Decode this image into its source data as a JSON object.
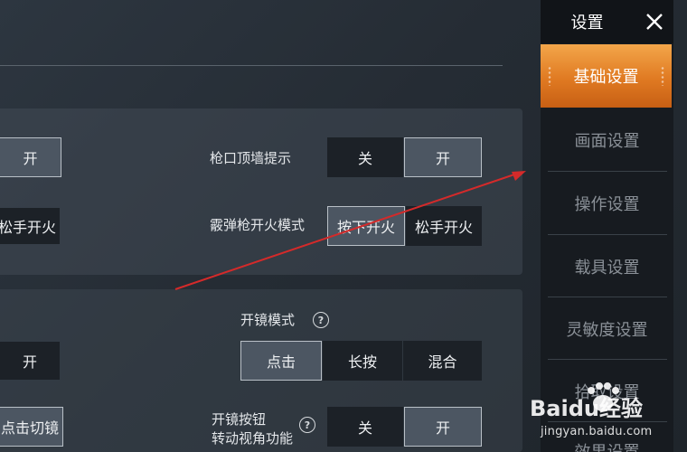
{
  "sidebar": {
    "title": "设置",
    "items": [
      {
        "label": "基础设置",
        "active": true
      },
      {
        "label": "画面设置"
      },
      {
        "label": "操作设置"
      },
      {
        "label": "载具设置"
      },
      {
        "label": "灵敏度设置"
      },
      {
        "label": "拾取设置"
      },
      {
        "label": "效果设置"
      }
    ]
  },
  "section1": {
    "left_toggle_on": "开",
    "left_fire_release": "松手开火",
    "muzzle_wall_hint": {
      "label": "枪口顶墙提示",
      "off": "关",
      "on": "开",
      "selected": "开"
    },
    "shotgun_fire_mode": {
      "label": "霰弹枪开火模式",
      "press": "按下开火",
      "release": "松手开火",
      "selected": "按下开火"
    }
  },
  "section2": {
    "left_toggle_on": "开",
    "left_click_switch": "点击切镜",
    "scope_mode": {
      "label": "开镜模式",
      "options": [
        "点击",
        "长按",
        "混合"
      ],
      "selected": "点击"
    },
    "scope_button_view": {
      "label_line1": "开镜按钮",
      "label_line2": "转动视角功能",
      "off": "关",
      "on": "开",
      "selected": "开"
    }
  },
  "watermark": {
    "brand": "Baidu经验",
    "url": "jingyan.baidu.com"
  },
  "colors": {
    "accent": "#e07a22",
    "annotation_arrow": "#d42a2a"
  }
}
